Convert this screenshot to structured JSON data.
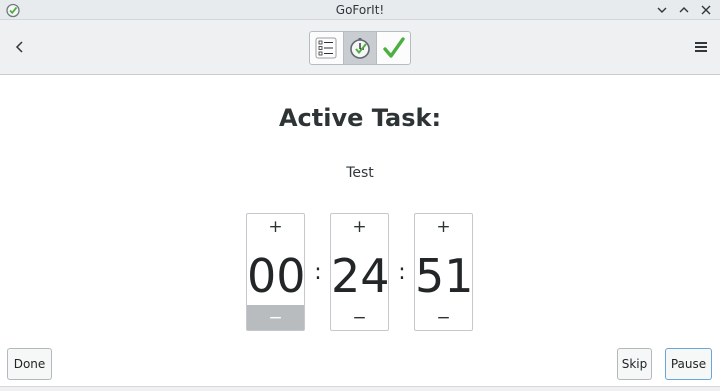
{
  "window": {
    "title": "GoForIt!",
    "controls": [
      "minimize",
      "maximize",
      "close"
    ]
  },
  "header": {
    "back_icon": "chevron-left-icon",
    "menu_icon": "hamburger-menu-icon",
    "view_switcher": [
      {
        "name": "task-list",
        "icon": "list-icon",
        "active": false
      },
      {
        "name": "timer",
        "icon": "clock-icon",
        "active": true
      },
      {
        "name": "done",
        "icon": "checkmark-icon",
        "active": false
      }
    ]
  },
  "main": {
    "heading": "Active Task:",
    "task_name": "Test",
    "timer": {
      "hours": "00",
      "minutes": "24",
      "seconds": "51",
      "separator": ":",
      "increment_label": "+",
      "decrement_label": "−"
    }
  },
  "buttons": {
    "done": "Done",
    "skip": "Skip",
    "pause": "Pause"
  },
  "colors": {
    "checkmark": "#4caf3f",
    "header_bg": "#eff0f1",
    "active_toggle": "#c9ccd0"
  }
}
